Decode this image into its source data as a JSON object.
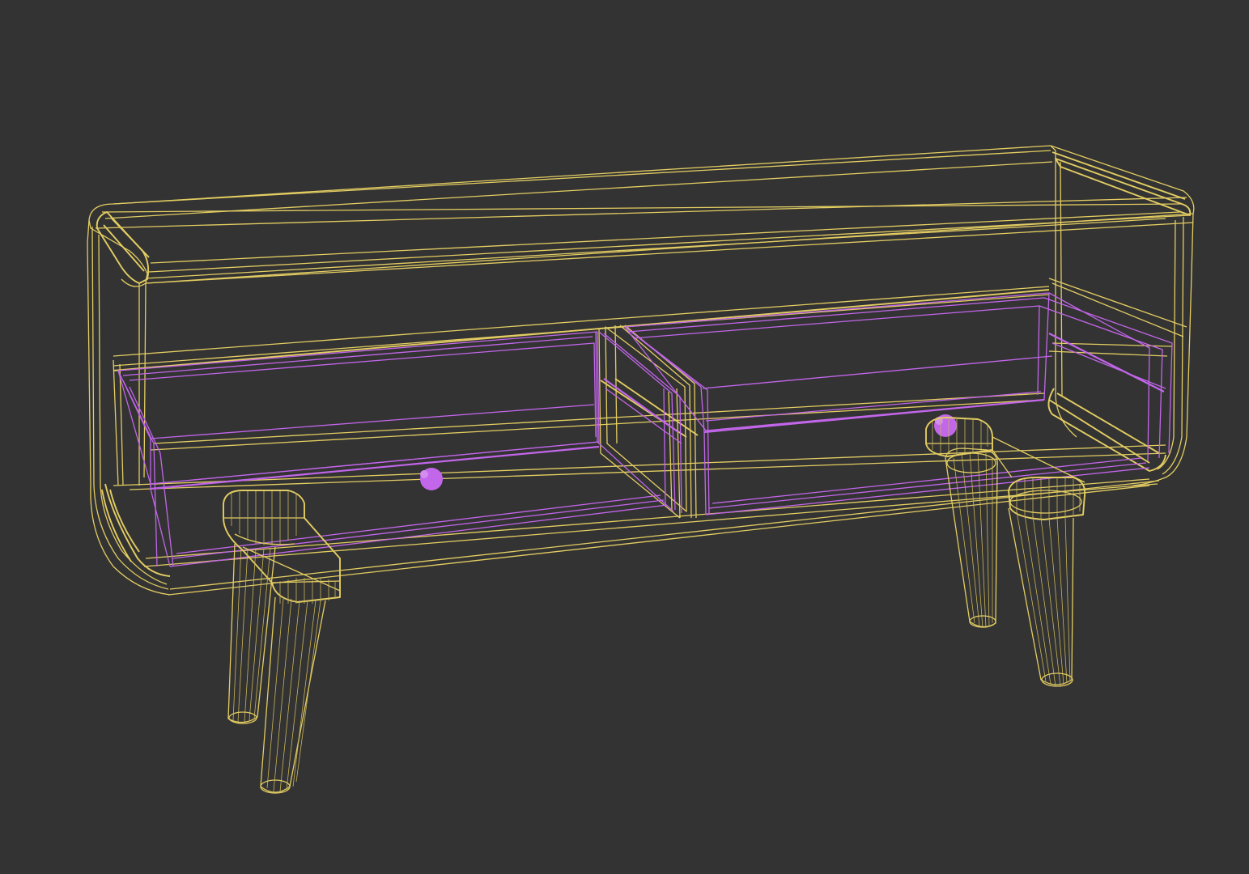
{
  "viewport": {
    "background": "#333333",
    "render_mode": "wireframe"
  },
  "colors": {
    "body_wire": "#e3cd62",
    "drawer_wire": "#c266ea",
    "knob": "#c266ea"
  },
  "scene": {
    "object": "sideboard-cabinet",
    "parts": [
      "cabinet-body",
      "drawer-left",
      "drawer-right",
      "knob-left",
      "knob-right",
      "leg-front-left",
      "leg-back-left",
      "leg-front-right",
      "leg-back-right"
    ]
  }
}
